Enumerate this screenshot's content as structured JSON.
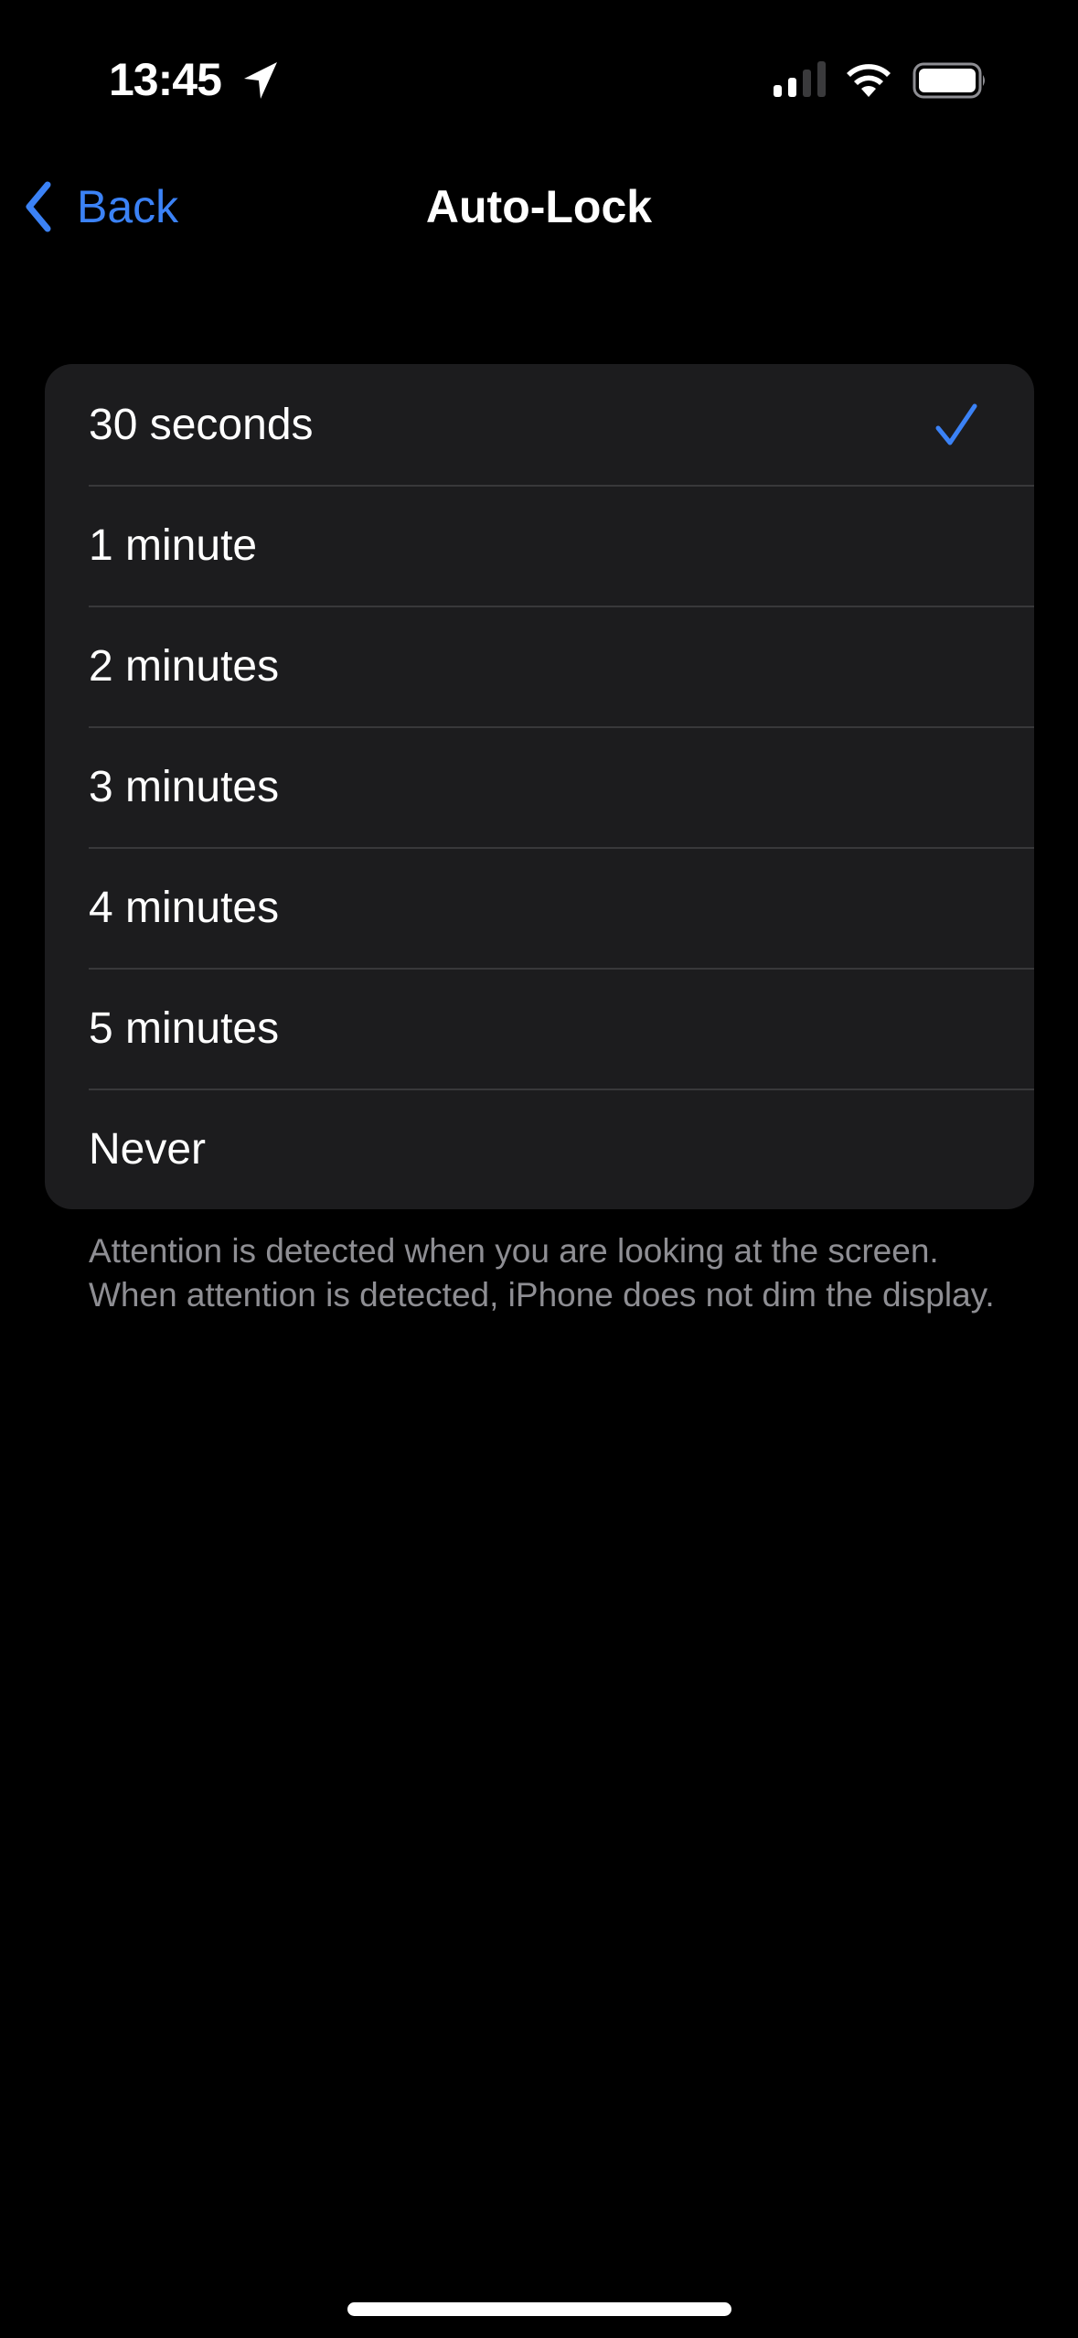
{
  "status_bar": {
    "time": "13:45",
    "icons": [
      "location-arrow-icon",
      "cellular-signal-icon",
      "wifi-icon",
      "battery-icon"
    ],
    "signal_bars_active": 2,
    "signal_bars_total": 4
  },
  "nav": {
    "back_label": "Back",
    "title": "Auto-Lock"
  },
  "options": [
    {
      "label": "30 seconds",
      "selected": true
    },
    {
      "label": "1 minute",
      "selected": false
    },
    {
      "label": "2 minutes",
      "selected": false
    },
    {
      "label": "3 minutes",
      "selected": false
    },
    {
      "label": "4 minutes",
      "selected": false
    },
    {
      "label": "5 minutes",
      "selected": false
    },
    {
      "label": "Never",
      "selected": false
    }
  ],
  "footer_text": "Attention is detected when you are looking at the screen. When attention is detected, iPhone does not dim the display.",
  "colors": {
    "accent": "#3b82f6",
    "background": "#000000",
    "card": "#1c1c1e",
    "secondary_text": "#8e8e93"
  }
}
